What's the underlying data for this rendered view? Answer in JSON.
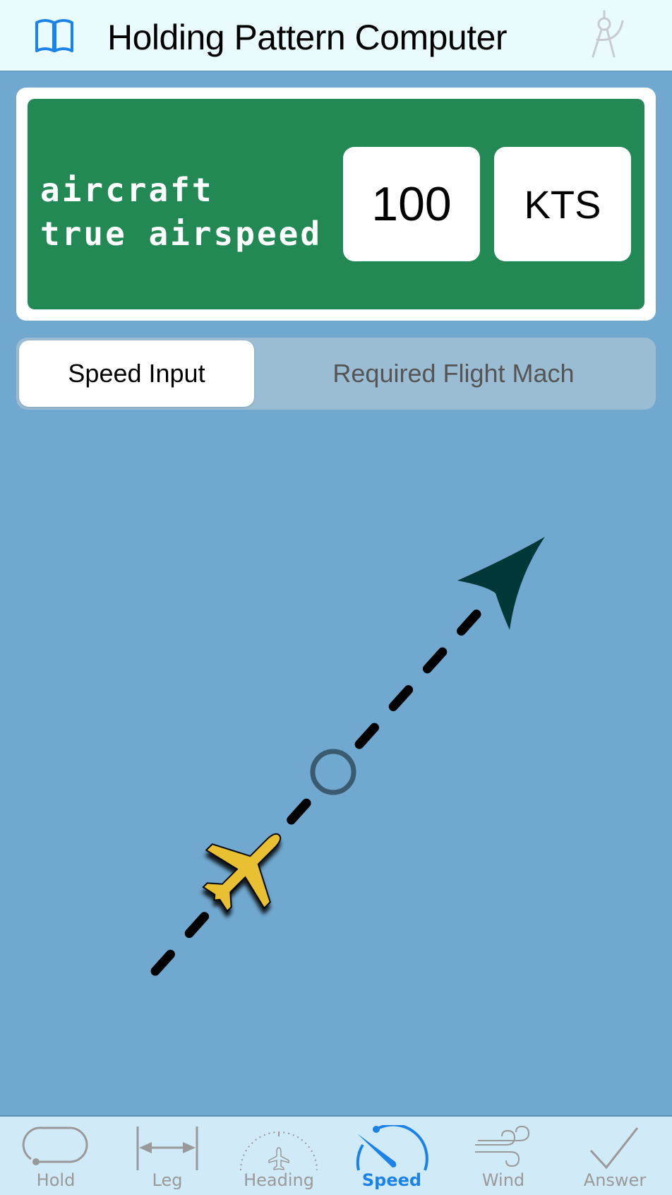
{
  "header": {
    "title": "Holding Pattern Computer",
    "left_icon": "book-icon",
    "right_icon": "compass-icon"
  },
  "input_panel": {
    "label_line1": "aircraft",
    "label_line2": "true airspeed",
    "value": "100",
    "unit": "KTS"
  },
  "segmented_control": {
    "options": [
      {
        "label": "Speed Input",
        "selected": true
      },
      {
        "label": "Required Flight Mach",
        "selected": false
      }
    ]
  },
  "diagram": {
    "aircraft_icon": "airplane-icon",
    "fix_icon": "fix-circle-icon",
    "direction_icon": "heading-arrow-icon",
    "colors": {
      "aircraft": "#e8c030",
      "arrow": "#003838",
      "fix": "#3a5a70",
      "track": "#000000"
    }
  },
  "tabbar": {
    "tabs": [
      {
        "label": "Hold",
        "icon": "hold-icon",
        "active": false
      },
      {
        "label": "Leg",
        "icon": "leg-icon",
        "active": false
      },
      {
        "label": "Heading",
        "icon": "heading-dial-icon",
        "active": false
      },
      {
        "label": "Speed",
        "icon": "speedometer-icon",
        "active": true
      },
      {
        "label": "Wind",
        "icon": "wind-icon",
        "active": false
      },
      {
        "label": "Answer",
        "icon": "checkmark-icon",
        "active": false
      }
    ]
  }
}
